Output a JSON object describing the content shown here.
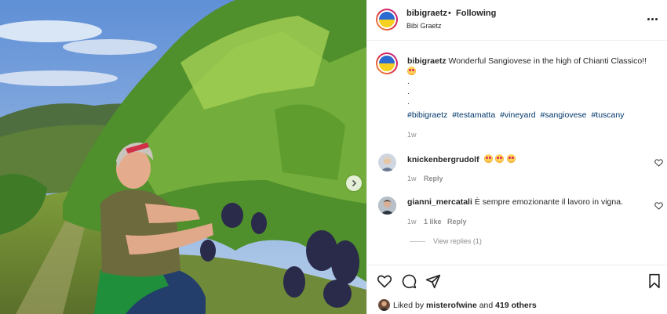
{
  "post": {
    "username": "bibigraetz",
    "separator": "•",
    "follow_status": "Following",
    "subtitle": "Bibi Graetz"
  },
  "caption": {
    "username": "bibigraetz",
    "text": "Wonderful Sangiovese in the high of Chianti Classico!!",
    "dots": [
      ".",
      ".",
      "."
    ],
    "hashtags": [
      "#bibigraetz",
      "#testamatta",
      "#vineyard",
      "#sangiovese",
      "#tuscany"
    ],
    "time": "1w"
  },
  "comments": [
    {
      "username": "knickenbergrudolf",
      "text": "",
      "emoji_count": 3,
      "time": "1w",
      "reply_label": "Reply"
    },
    {
      "username": "gianni_mercatali",
      "text": "È sempre emozionante il lavoro in vigna.",
      "time": "1w",
      "likes": "1 like",
      "reply_label": "Reply",
      "view_replies": "View replies (1)"
    }
  ],
  "likes": {
    "prefix": "Liked by",
    "user": "misterofwine",
    "conjunction": "and",
    "others": "419 others"
  },
  "icons": {
    "more": "more-options-icon",
    "next": "chevron-right-icon",
    "like": "heart-icon",
    "comment": "comment-icon",
    "share": "share-icon",
    "save": "bookmark-icon"
  },
  "colors": {
    "link": "#00376b",
    "muted": "#8e8e8e",
    "text": "#262626"
  }
}
